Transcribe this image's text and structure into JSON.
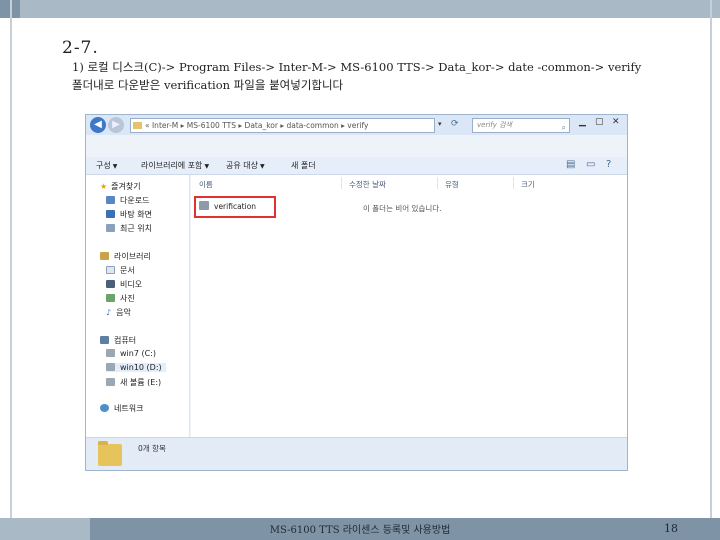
{
  "slide": {
    "section_title": "2-7.",
    "instruction": "1) 로컬 디스크(C)-> Program Files-> Inter-M-> MS-6100 TTS-> Data_kor-> date -common-> verify 폴더내로 다운받은 verification 파일을 붙여넣기합니다",
    "footer": "MS-6100 TTS 라이센스 등록및 사용방법",
    "page_number": "18"
  },
  "explorer": {
    "address_path": "« Inter-M ▸ MS-6100 TTS ▸ Data_kor ▸ data-common ▸ verify",
    "search_placeholder": "verify 검색",
    "toolbar": {
      "organize": "구성",
      "include_library": "라이브러리에 포함",
      "share": "공유 대상",
      "new_folder": "새 폴더"
    },
    "nav": {
      "favorites": "즐겨찾기",
      "downloads": "다운로드",
      "desktop": "바탕 화면",
      "recent": "최근 위치",
      "libraries": "라이브러리",
      "documents": "문서",
      "videos": "비디오",
      "pictures": "사진",
      "music": "음악",
      "computer": "컴퓨터",
      "drive_c": "win7 (C:)",
      "drive_d": "win10 (D:)",
      "drive_e": "새 볼륨 (E:)",
      "network": "네트워크"
    },
    "columns": {
      "name": "이름",
      "modified": "수정한 날짜",
      "type": "유형",
      "size": "크기"
    },
    "empty_message": "이 폴더는 비어 있습니다.",
    "file_name": "verification",
    "detail_text": "0개 항목"
  },
  "colors": {
    "highlight": "#e03131",
    "folder": "#e7c35b"
  }
}
